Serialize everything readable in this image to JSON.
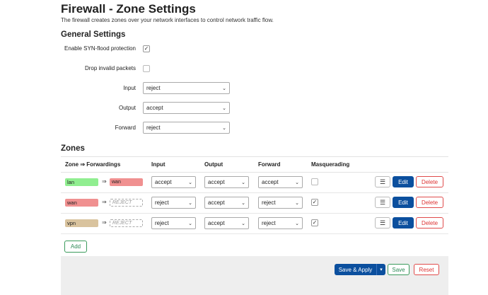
{
  "page": {
    "title": "Firewall - Zone Settings",
    "description": "The firewall creates zones over your network interfaces to control network traffic flow."
  },
  "general": {
    "heading": "General Settings",
    "syn_flood": {
      "label": "Enable SYN-flood protection",
      "checked": true
    },
    "drop_invalid": {
      "label": "Drop invalid packets",
      "checked": false
    },
    "input": {
      "label": "Input",
      "value": "reject"
    },
    "output": {
      "label": "Output",
      "value": "accept"
    },
    "forward": {
      "label": "Forward",
      "value": "reject"
    }
  },
  "zones": {
    "heading": "Zones",
    "columns": [
      "Zone ⇒ Forwardings",
      "Input",
      "Output",
      "Forward",
      "Masquerading"
    ],
    "forward_arrow": "⇒",
    "rows": [
      {
        "zone": "lan",
        "zone_color": "#90ee90",
        "forward": "wan",
        "forward_color": "#f09090",
        "forward_reject": false,
        "input": "accept",
        "output": "accept",
        "forwardpol": "accept",
        "masq": false,
        "masq_mark": ""
      },
      {
        "zone": "wan",
        "zone_color": "#f09090",
        "forward": "REJECT",
        "forward_color": "#ffffff",
        "forward_reject": true,
        "input": "reject",
        "output": "accept",
        "forwardpol": "reject",
        "masq": true,
        "masq_mark": "✓"
      },
      {
        "zone": "vpn",
        "zone_color": "#d9c39e",
        "forward": "REJECT",
        "forward_color": "#ffffff",
        "forward_reject": true,
        "input": "reject",
        "output": "accept",
        "forwardpol": "reject",
        "masq": true,
        "masq_mark": "✓"
      }
    ],
    "actions": {
      "list_icon": "☰",
      "edit": "Edit",
      "delete": "Delete"
    },
    "add_label": "Add"
  },
  "footer": {
    "save_apply": "Save & Apply",
    "dropdown_icon": "▾",
    "save": "Save",
    "reset": "Reset"
  },
  "icons": {
    "checkbox_check": "✓",
    "select_chevron": "⌄"
  }
}
